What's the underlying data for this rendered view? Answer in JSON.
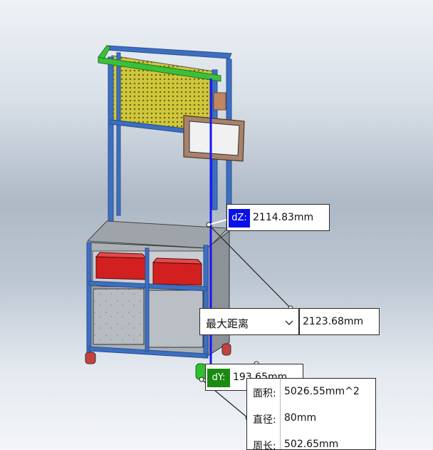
{
  "dz_measure": {
    "tag": "dZ:",
    "value": "2114.83mm",
    "tag_color": "#0a10e8"
  },
  "max_distance": {
    "mode": "最大距离",
    "value": "2123.68mm"
  },
  "dy_measure": {
    "tag": "dY:",
    "value": "193.65mm",
    "tag_color": "#1a8a10"
  },
  "circle_info": {
    "area_label": "面积:",
    "area_value": "5026.55mm^2",
    "diameter_label": "直径:",
    "diameter_value": "80mm",
    "perimeter_label": "周长:",
    "perimeter_value": "502.65mm"
  },
  "icons": {
    "dropdown": "chevron-down-icon"
  },
  "colors": {
    "frame": "#3d6fc0",
    "mesh_panel": "#c8c233",
    "top_rail": "#3cc03c",
    "cabinet": "#aab0b6",
    "crate": "#d22020",
    "monitor": "#a8826a",
    "measure_line": "#1515ff"
  }
}
